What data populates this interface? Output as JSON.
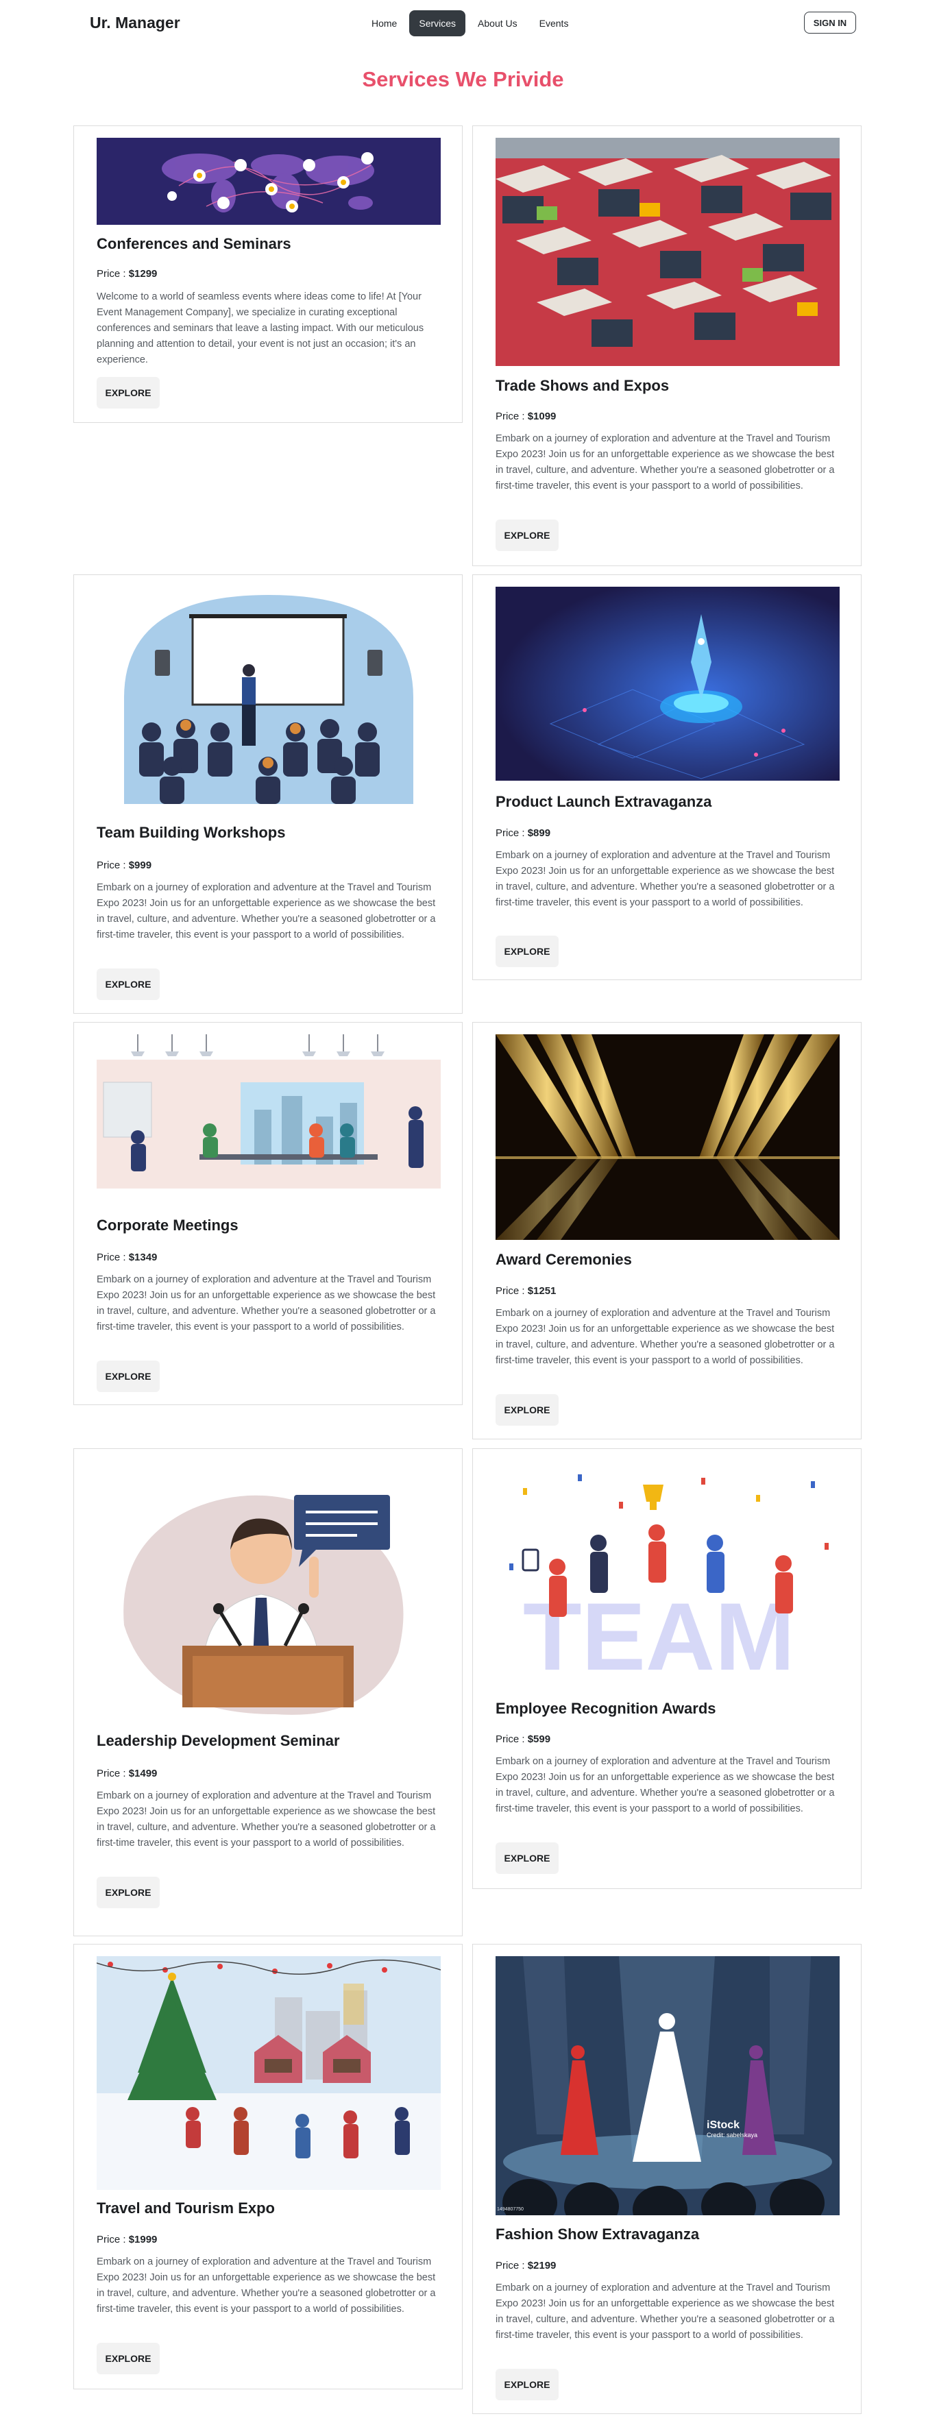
{
  "nav": {
    "brand": "Ur. Manager",
    "links": [
      "Home",
      "Services",
      "About Us",
      "Events"
    ],
    "active": "Services",
    "signin": "SIGN IN"
  },
  "heading": "Services We Privide",
  "price_prefix": "Price : ",
  "generic_desc": "Embark on a journey of exploration and adventure at the Travel and Tourism Expo 2023! Join us for an unforgettable experience as we showcase the best in travel, culture, and adventure. Whether you're a seasoned globetrotter or a first-time traveler, this event is your passport to a world of possibilities.",
  "cards": [
    {
      "title": "Conferences and Seminars",
      "price": "$1299",
      "button": "EXPLORE",
      "image": "world-network-illustration",
      "desc": "Welcome to a world of seamless events where ideas come to life! At [Your Event Management Company], we specialize in curating exceptional conferences and seminars that leave a lasting impact. With our meticulous planning and attention to detail, your event is not just an occasion; it's an experience."
    },
    {
      "title": "Trade Shows and Expos",
      "price": "$1099",
      "button": "EXPLORE",
      "image": "expo-hall-illustration"
    },
    {
      "title": "Team Building Workshops",
      "price": "$999",
      "button": "EXPLORE",
      "image": "presentation-audience-illustration"
    },
    {
      "title": "Product Launch Extravaganza",
      "price": "$899",
      "button": "EXPLORE",
      "image": "rocket-launch-illustration"
    },
    {
      "title": "Corporate Meetings",
      "price": "$1349",
      "button": "EXPLORE",
      "image": "office-illustration"
    },
    {
      "title": "Award Ceremonies",
      "price": "$1251",
      "button": "EXPLORE",
      "image": "golden-stage-photo"
    },
    {
      "title": "Leadership Development Seminar",
      "price": "$1499",
      "button": "EXPLORE",
      "image": "speaker-podium-illustration"
    },
    {
      "title": "Employee Recognition Awards",
      "price": "$599",
      "button": "EXPLORE",
      "image": "team-celebration-illustration"
    },
    {
      "title": "Travel and Tourism Expo",
      "price": "$1999",
      "button": "EXPLORE",
      "image": "winter-market-illustration"
    },
    {
      "title": "Fashion Show Extravaganza",
      "price": "$2199",
      "button": "EXPLORE",
      "image": "fashion-runway-illustration",
      "watermark": "iStock",
      "watermark_credit": "Credit: sabelskaya",
      "watermark_code": "1494807750"
    }
  ],
  "colors": {
    "accent": "#e8506b",
    "nav_active": "#343a40",
    "button_bg": "#f2f2f2"
  }
}
